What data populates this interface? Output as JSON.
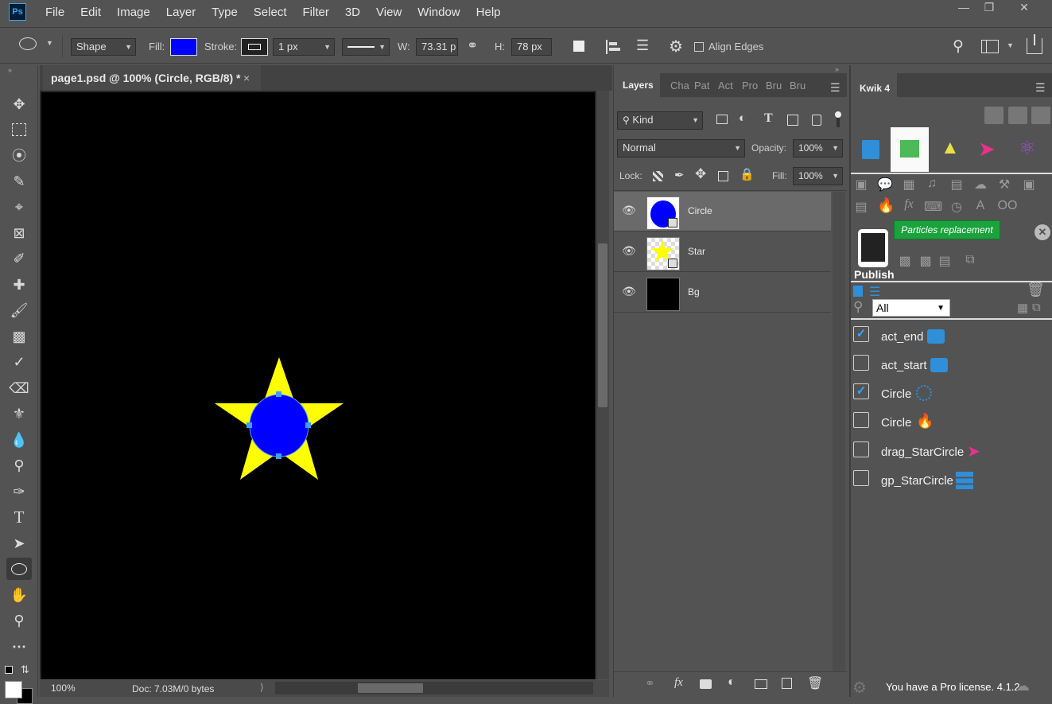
{
  "app": {
    "logo_text": "Ps"
  },
  "menu": [
    "File",
    "Edit",
    "Image",
    "Layer",
    "Type",
    "Select",
    "Filter",
    "3D",
    "View",
    "Window",
    "Help"
  ],
  "window_controls": {
    "minimize": "—",
    "restore": "❐",
    "close": "✕"
  },
  "options": {
    "tool_mode": "Shape",
    "fill_label": "Fill:",
    "fill_color": "#0000ff",
    "stroke_label": "Stroke:",
    "stroke_width": "1 px",
    "w_label": "W:",
    "w_value": "73.31 p",
    "h_label": "H:",
    "h_value": "78 px",
    "align_edges_label": "Align Edges"
  },
  "document": {
    "tab_title": "page1.psd @ 100% (Circle, RGB/8) *",
    "close_glyph": "×",
    "zoom": "100%",
    "doc_info": "Doc: 7.03M/0 bytes",
    "canvas_color": "#000000",
    "star_color": "#ffff00",
    "circle_color": "#0000ff"
  },
  "layers_panel": {
    "tabs": [
      "Layers",
      "Cha",
      "Pat",
      "Act",
      "Pro",
      "Bru",
      "Bru"
    ],
    "filter_kind": "Kind",
    "blend_mode": "Normal",
    "opacity_label": "Opacity:",
    "opacity_value": "100%",
    "lock_label": "Lock:",
    "fill_label": "Fill:",
    "fill_value": "100%",
    "layers": [
      {
        "name": "Circle",
        "selected": true
      },
      {
        "name": "Star",
        "selected": false
      },
      {
        "name": "Bg",
        "selected": false
      }
    ]
  },
  "kwik": {
    "tab_title": "Kwik 4",
    "tooltip": "Particles replacement",
    "publish_label": "Publish",
    "filter_value": "All",
    "items": [
      {
        "label": "act_end",
        "checked": true,
        "icon": "action-icon"
      },
      {
        "label": "act_start",
        "checked": false,
        "icon": "action-icon"
      },
      {
        "label": "Circle",
        "checked": true,
        "icon": "spinner-icon"
      },
      {
        "label": "Circle",
        "checked": false,
        "icon": "flame-icon"
      },
      {
        "label": "drag_StarCircle",
        "checked": false,
        "icon": "drag-cursor-icon"
      },
      {
        "label": "gp_StarCircle",
        "checked": false,
        "icon": "layers-stack-icon"
      }
    ],
    "license_text": "You have a Pro license. 4.1.2"
  }
}
